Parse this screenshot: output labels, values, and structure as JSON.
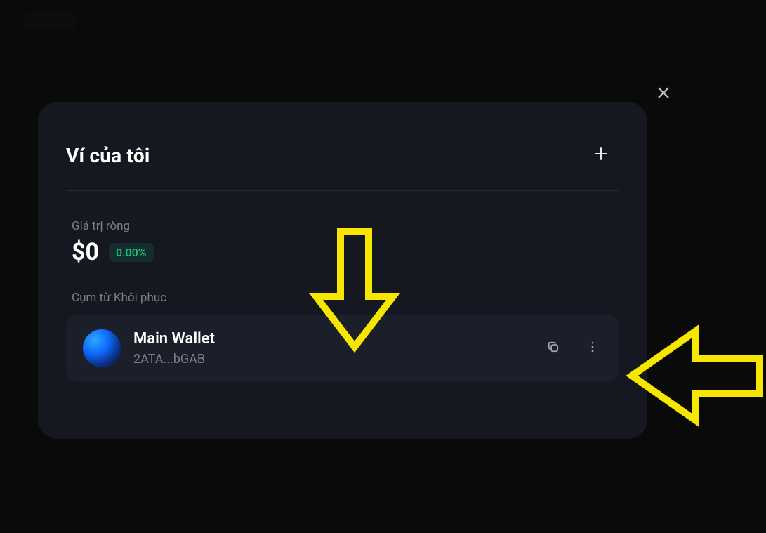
{
  "modal": {
    "title": "Ví của tôi"
  },
  "stats": {
    "label": "Giá trị ròng",
    "amount": "$0",
    "percent": "0.00%"
  },
  "section": {
    "recovery_label": "Cụm từ Khôi phục"
  },
  "wallet": {
    "name": "Main Wallet",
    "address": "2ATA...bGAB"
  },
  "colors": {
    "accent_green": "#16c784",
    "arrow_yellow": "#f6e600"
  }
}
